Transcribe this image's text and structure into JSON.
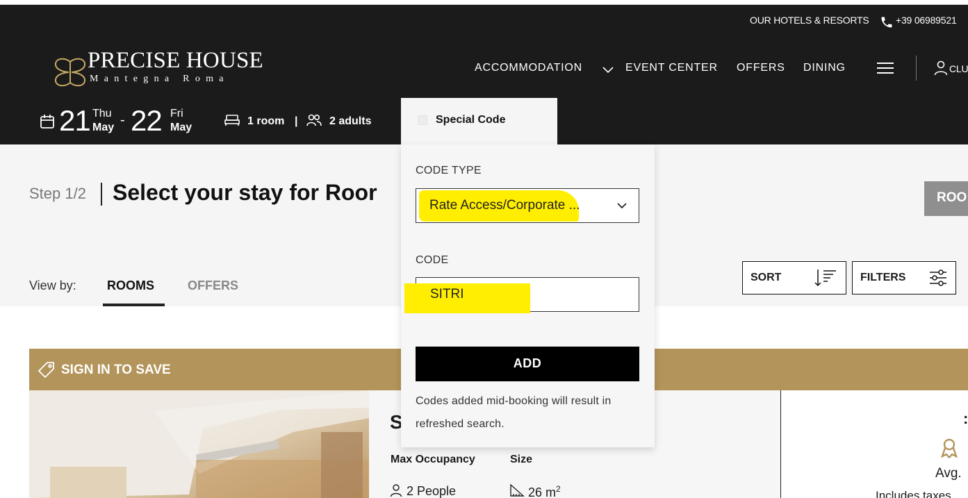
{
  "header": {
    "utility_link": "OUR HOTELS & RESORTS",
    "phone": "+39 06989521",
    "logo_title": "PRECISE HOUSE",
    "logo_subtitle": "Mantegna Roma",
    "nav": [
      "ACCOMMODATION",
      "EVENT CENTER",
      "OFFERS",
      "DINING"
    ],
    "account_label": "CLU"
  },
  "booking": {
    "checkin_day": "21",
    "checkin_weekday": "Thu",
    "checkin_month": "May",
    "separator": "-",
    "checkout_day": "22",
    "checkout_weekday": "Fri",
    "checkout_month": "May",
    "rooms": "1 room",
    "pipe": "|",
    "guests": "2 adults",
    "special_code_tab": "Special Code"
  },
  "page": {
    "step": "Step 1/2",
    "title": "Select your stay for Roor",
    "room_button": "ROO",
    "view_by_label": "View by:",
    "tabs": [
      "ROOMS",
      "OFFERS"
    ],
    "active_tab": "ROOMS",
    "sort_label": "SORT",
    "filters_label": "FILTERS"
  },
  "promo": {
    "sign_in_label": "SIGN IN TO SAVE"
  },
  "room_card": {
    "name_initial": "S",
    "max_occupancy_label": "Max Occupancy",
    "size_label": "Size",
    "occupancy_value": "2 People",
    "size_value": "26 m",
    "size_unit_sup": "2",
    "right_avg": "Avg.",
    "right_note": "Includes taxes",
    "right_top_char": ":"
  },
  "special_code_popup": {
    "code_type_label": "CODE TYPE",
    "code_type_value": "Rate Access/Corporate ...",
    "code_label": "CODE",
    "code_value": "SITRI",
    "add_button": "ADD",
    "note": "Codes added mid-booking will result in refreshed search."
  },
  "colors": {
    "header_bg": "#1b1b1b",
    "accent_gold": "#b3945a",
    "highlight": "#ffee00",
    "roo_button": "#8f8f8f"
  }
}
